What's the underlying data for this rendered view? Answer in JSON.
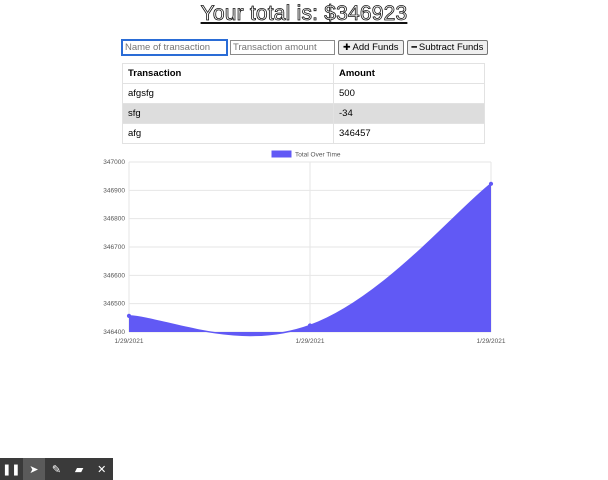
{
  "header": {
    "total_text": "Your total is: $346923"
  },
  "form": {
    "name_placeholder": "Name of transaction",
    "amount_placeholder": "Transaction amount",
    "add_label": "Add Funds",
    "subtract_label": "Subtract Funds"
  },
  "table": {
    "headers": [
      "Transaction",
      "Amount"
    ],
    "rows": [
      {
        "name": "afgsfg",
        "amount": "500"
      },
      {
        "name": "sfg",
        "amount": "-34"
      },
      {
        "name": "afg",
        "amount": "346457"
      }
    ]
  },
  "chart_data": {
    "type": "area",
    "title": "",
    "legend": [
      "Total Over Time"
    ],
    "legend_position": "top",
    "x": [
      "1/29/2021",
      "1/29/2021",
      "1/29/2021"
    ],
    "series": [
      {
        "name": "Total Over Time",
        "values": [
          346457,
          346423,
          346923
        ],
        "color": "#6159f5"
      }
    ],
    "ylim": [
      346400,
      347000
    ],
    "yticks": [
      346400,
      346500,
      346600,
      346700,
      346800,
      346900,
      347000
    ],
    "grid": true
  },
  "toolbar": {
    "icons": [
      "pause-icon",
      "pointer-icon",
      "pen-icon",
      "eraser-icon",
      "close-icon"
    ]
  }
}
